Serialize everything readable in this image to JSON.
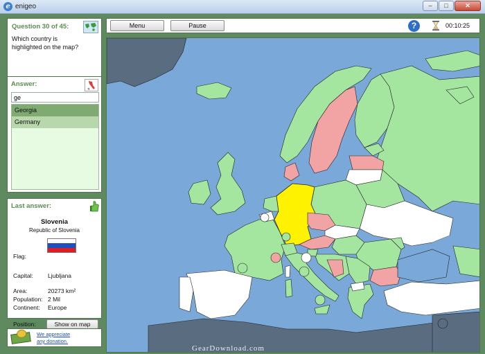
{
  "window": {
    "title": "enigeo",
    "app_icon_glyph": "e"
  },
  "window_buttons": {
    "minimize": "–",
    "maximize": "□",
    "close": "✕"
  },
  "question": {
    "header": "Question 30 of 45:",
    "text_line1": "Which country is",
    "text_line2": "highlighted on the map?",
    "globe_icon": "world-map-icon"
  },
  "answer": {
    "header": "Answer:",
    "input_value": "ge",
    "options": [
      "Georgia",
      "Germany"
    ],
    "selected_index": 0
  },
  "last_answer": {
    "header": "Last answer:",
    "country": "Slovenia",
    "official_name": "Republic of Slovenia",
    "flag_label": "Flag:",
    "capital_label": "Capital:",
    "capital": "Ljubljana",
    "area_label": "Area:",
    "area": "20273 km²",
    "population_label": "Population:",
    "population": "2 Mil",
    "continent_label": "Continent:",
    "continent": "Europe",
    "position_label": "Position:",
    "show_on_map": "Show on map",
    "flag_colors": [
      "#ffffff",
      "#1f4fbf",
      "#dd1f24"
    ]
  },
  "donation": {
    "line1": "We appreciate",
    "line2": "any donation."
  },
  "toolbar": {
    "menu": "Menu",
    "pause": "Pause",
    "help": "?",
    "timer": "00:10:25"
  },
  "watermark": "GearDownload.com",
  "colors": {
    "sea": "#7aa9d9",
    "correct": "#a4e6a0",
    "wrong": "#f2a3a3",
    "unanswered": "#ffffff",
    "highlighted": "#fff200",
    "outside": "#5a6c7f"
  }
}
